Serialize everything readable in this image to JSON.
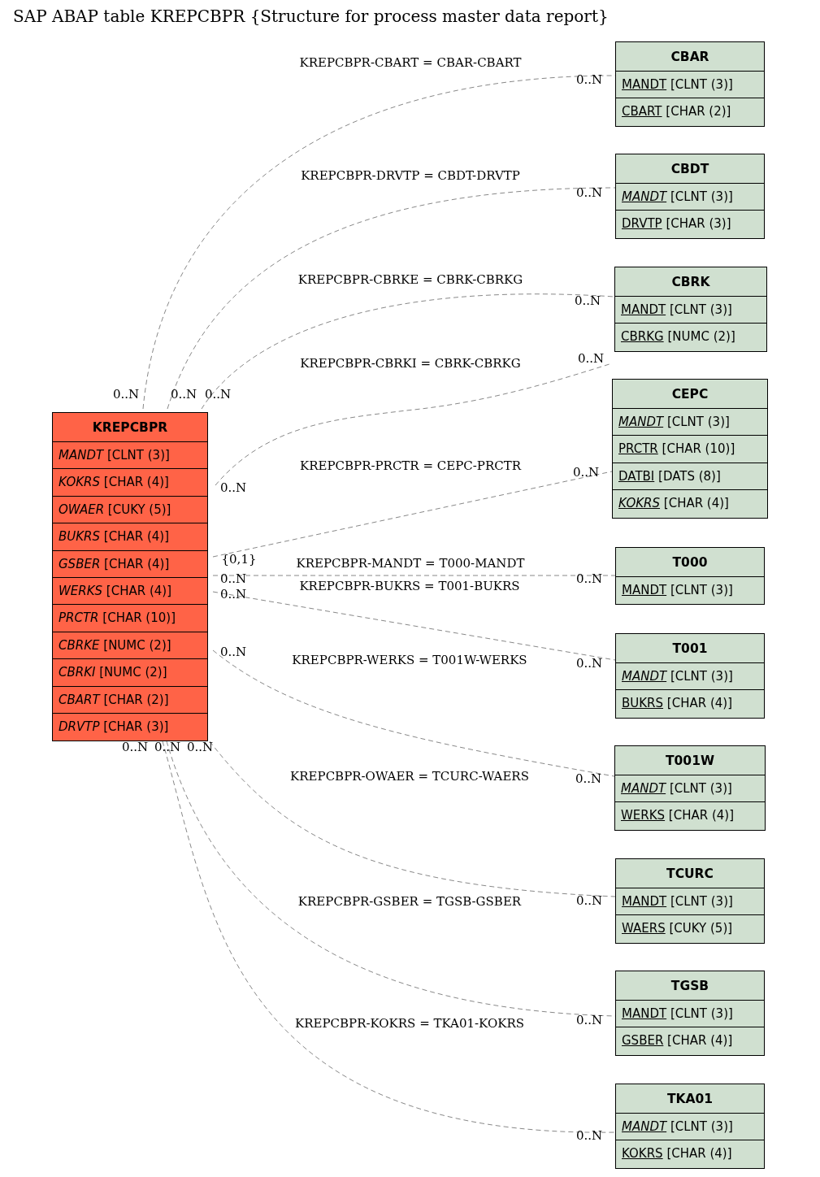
{
  "title": "SAP ABAP table KREPCBPR {Structure for process master data report}",
  "tables": [
    {
      "name": "KREPCBPR",
      "kind": "main",
      "fields": [
        {
          "name": "MANDT",
          "type": "[CLNT (3)]",
          "key": false,
          "foreign": true
        },
        {
          "name": "KOKRS",
          "type": "[CHAR (4)]",
          "key": false,
          "foreign": true
        },
        {
          "name": "OWAER",
          "type": "[CUKY (5)]",
          "key": false,
          "foreign": true
        },
        {
          "name": "BUKRS",
          "type": "[CHAR (4)]",
          "key": false,
          "foreign": true
        },
        {
          "name": "GSBER",
          "type": "[CHAR (4)]",
          "key": false,
          "foreign": true
        },
        {
          "name": "WERKS",
          "type": "[CHAR (4)]",
          "key": false,
          "foreign": true
        },
        {
          "name": "PRCTR",
          "type": "[CHAR (10)]",
          "key": false,
          "foreign": true
        },
        {
          "name": "CBRKE",
          "type": "[NUMC (2)]",
          "key": false,
          "foreign": true
        },
        {
          "name": "CBRKI",
          "type": "[NUMC (2)]",
          "key": false,
          "foreign": true
        },
        {
          "name": "CBART",
          "type": "[CHAR (2)]",
          "key": false,
          "foreign": true
        },
        {
          "name": "DRVTP",
          "type": "[CHAR (3)]",
          "key": false,
          "foreign": true
        }
      ]
    },
    {
      "name": "CBAR",
      "kind": "related",
      "fields": [
        {
          "name": "MANDT",
          "type": "[CLNT (3)]",
          "key": true,
          "foreign": false
        },
        {
          "name": "CBART",
          "type": "[CHAR (2)]",
          "key": true,
          "foreign": false
        }
      ]
    },
    {
      "name": "CBDT",
      "kind": "related",
      "fields": [
        {
          "name": "MANDT",
          "type": "[CLNT (3)]",
          "key": true,
          "foreign": true
        },
        {
          "name": "DRVTP",
          "type": "[CHAR (3)]",
          "key": true,
          "foreign": false
        }
      ]
    },
    {
      "name": "CBRK",
      "kind": "related",
      "fields": [
        {
          "name": "MANDT",
          "type": "[CLNT (3)]",
          "key": true,
          "foreign": false
        },
        {
          "name": "CBRKG",
          "type": "[NUMC (2)]",
          "key": true,
          "foreign": false
        }
      ]
    },
    {
      "name": "CEPC",
      "kind": "related",
      "fields": [
        {
          "name": "MANDT",
          "type": "[CLNT (3)]",
          "key": true,
          "foreign": true
        },
        {
          "name": "PRCTR",
          "type": "[CHAR (10)]",
          "key": true,
          "foreign": false
        },
        {
          "name": "DATBI",
          "type": "[DATS (8)]",
          "key": true,
          "foreign": false
        },
        {
          "name": "KOKRS",
          "type": "[CHAR (4)]",
          "key": true,
          "foreign": true
        }
      ]
    },
    {
      "name": "T000",
      "kind": "related",
      "fields": [
        {
          "name": "MANDT",
          "type": "[CLNT (3)]",
          "key": true,
          "foreign": false
        }
      ]
    },
    {
      "name": "T001",
      "kind": "related",
      "fields": [
        {
          "name": "MANDT",
          "type": "[CLNT (3)]",
          "key": true,
          "foreign": true
        },
        {
          "name": "BUKRS",
          "type": "[CHAR (4)]",
          "key": true,
          "foreign": false
        }
      ]
    },
    {
      "name": "T001W",
      "kind": "related",
      "fields": [
        {
          "name": "MANDT",
          "type": "[CLNT (3)]",
          "key": true,
          "foreign": true
        },
        {
          "name": "WERKS",
          "type": "[CHAR (4)]",
          "key": true,
          "foreign": false
        }
      ]
    },
    {
      "name": "TCURC",
      "kind": "related",
      "fields": [
        {
          "name": "MANDT",
          "type": "[CLNT (3)]",
          "key": true,
          "foreign": false
        },
        {
          "name": "WAERS",
          "type": "[CUKY (5)]",
          "key": true,
          "foreign": false
        }
      ]
    },
    {
      "name": "TGSB",
      "kind": "related",
      "fields": [
        {
          "name": "MANDT",
          "type": "[CLNT (3)]",
          "key": true,
          "foreign": false
        },
        {
          "name": "GSBER",
          "type": "[CHAR (4)]",
          "key": true,
          "foreign": false
        }
      ]
    },
    {
      "name": "TKA01",
      "kind": "related",
      "fields": [
        {
          "name": "MANDT",
          "type": "[CLNT (3)]",
          "key": true,
          "foreign": true
        },
        {
          "name": "KOKRS",
          "type": "[CHAR (4)]",
          "key": true,
          "foreign": false
        }
      ]
    }
  ],
  "relations": [
    {
      "label": "KREPCBPR-CBART = CBAR-CBART",
      "source_cardinality": "0..N",
      "target_cardinality": "0..N"
    },
    {
      "label": "KREPCBPR-DRVTP = CBDT-DRVTP",
      "source_cardinality": "0..N",
      "target_cardinality": "0..N"
    },
    {
      "label": "KREPCBPR-CBRKE = CBRK-CBRKG",
      "source_cardinality": "0..N",
      "target_cardinality": "0..N"
    },
    {
      "label": "KREPCBPR-CBRKI = CBRK-CBRKG",
      "source_cardinality": "0..N",
      "target_cardinality": "0..N"
    },
    {
      "label": "KREPCBPR-PRCTR = CEPC-PRCTR",
      "source_cardinality": "{0,1}",
      "target_cardinality": "0..N"
    },
    {
      "label": "KREPCBPR-MANDT = T000-MANDT",
      "source_cardinality": "0..N",
      "target_cardinality": "0..N"
    },
    {
      "label": "KREPCBPR-BUKRS = T001-BUKRS",
      "source_cardinality": "0..N",
      "target_cardinality": "0..N"
    },
    {
      "label": "KREPCBPR-WERKS = T001W-WERKS",
      "source_cardinality": "0..N",
      "target_cardinality": "0..N"
    },
    {
      "label": "KREPCBPR-OWAER = TCURC-WAERS",
      "source_cardinality": "0..N",
      "target_cardinality": "0..N"
    },
    {
      "label": "KREPCBPR-GSBER = TGSB-GSBER",
      "source_cardinality": "0..N",
      "target_cardinality": "0..N"
    },
    {
      "label": "KREPCBPR-KOKRS = TKA01-KOKRS",
      "source_cardinality": "0..N",
      "target_cardinality": "0..N"
    }
  ]
}
